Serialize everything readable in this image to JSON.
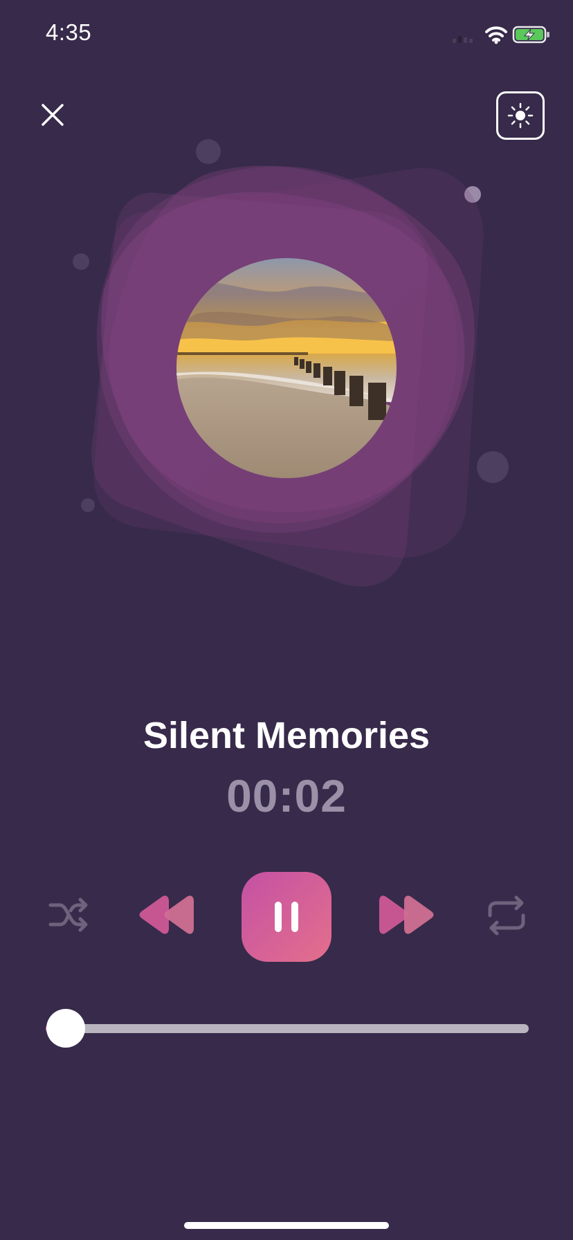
{
  "status_bar": {
    "time": "4:35",
    "icons": [
      "signal-icon",
      "wifi-icon",
      "battery-charging-icon"
    ],
    "battery_color": "#5ac85a"
  },
  "header": {
    "close_icon": "close-icon",
    "theme_icon": "sun-icon"
  },
  "player": {
    "track_title": "Silent Memories",
    "elapsed_time": "00:02",
    "progress_fraction": 0.03,
    "album_art": "beach-sunset-pier",
    "accent_gradient": [
      "#c451a4",
      "#e46f8c"
    ],
    "controls": [
      "shuffle-icon",
      "rewind-icon",
      "pause-icon",
      "fast-forward-icon",
      "repeat-icon"
    ]
  },
  "colors": {
    "background": "#372a4a",
    "time_text": "#9a90a8",
    "inactive_control": "#6e627d",
    "progress_track": "#b9b5be"
  }
}
